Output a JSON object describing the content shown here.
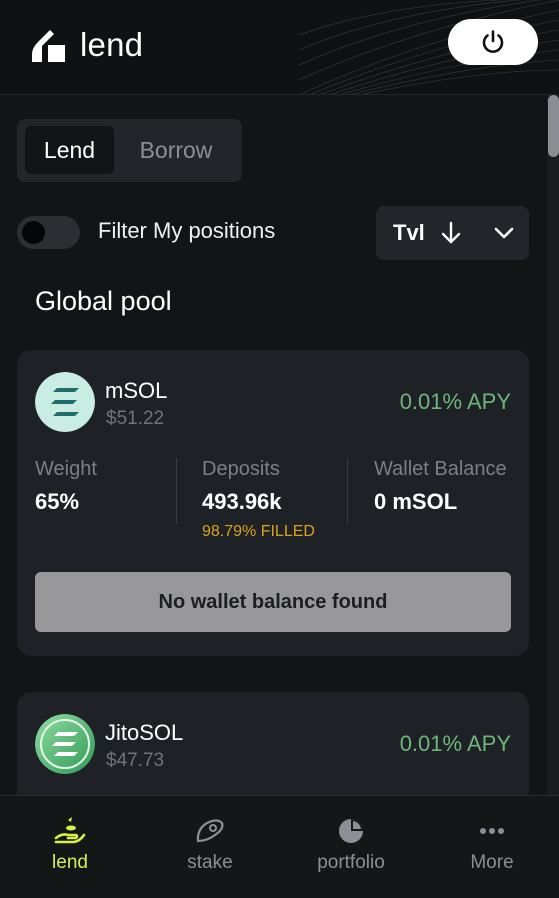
{
  "header": {
    "logo_text": "lend",
    "power_button": "power-icon"
  },
  "tabs": [
    {
      "label": "Lend",
      "active": true
    },
    {
      "label": "Borrow",
      "active": false
    }
  ],
  "filter": {
    "label": "Filter My positions",
    "enabled": false
  },
  "sort": {
    "label": "Tvl",
    "direction_icon": "arrow-down-icon",
    "dropdown_icon": "chevron-down-icon"
  },
  "section_title": "Global pool",
  "pools": [
    {
      "name": "mSOL",
      "price": "$51.22",
      "apy": "0.01% APY",
      "weight_label": "Weight",
      "weight_value": "65%",
      "deposits_label": "Deposits",
      "deposits_value": "493.96k",
      "filled": "98.79% FILLED",
      "wallet_label": "Wallet Balance",
      "wallet_value": "0 mSOL",
      "action_label": "No wallet balance found"
    },
    {
      "name": "JitoSOL",
      "price": "$47.73",
      "apy": "0.01% APY"
    }
  ],
  "bottom_nav": [
    {
      "label": "lend",
      "icon": "lend-icon",
      "active": true
    },
    {
      "label": "stake",
      "icon": "stake-icon",
      "active": false
    },
    {
      "label": "portfolio",
      "icon": "pie-chart-icon",
      "active": false
    },
    {
      "label": "More",
      "icon": "more-dots-icon",
      "active": false
    }
  ],
  "colors": {
    "accent": "#d6ef4e",
    "apy_green": "#6fb57a",
    "filled_orange": "#d9a21b",
    "background": "#121416",
    "card": "#1e2226"
  }
}
